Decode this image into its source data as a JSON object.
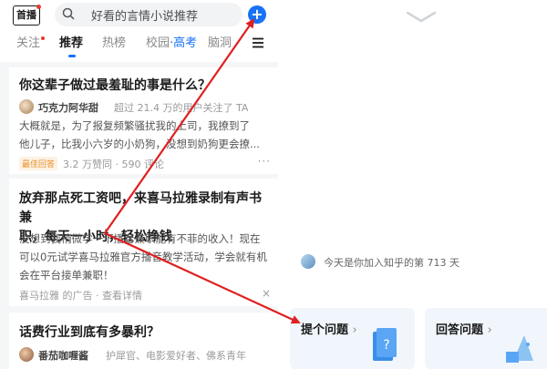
{
  "app": {
    "logo": "首播",
    "search_placeholder": "好看的言情小说推荐",
    "add_button": "+"
  },
  "tabs": [
    {
      "label": "关注"
    },
    {
      "label": "推荐"
    },
    {
      "label": "热榜"
    },
    {
      "label": "校园",
      "suffix": "·高考"
    },
    {
      "label": "脑洞"
    }
  ],
  "feed": [
    {
      "title": "你这辈子做过最羞耻的事是什么？",
      "author": "巧克力阿华甜",
      "meta": "超过 21.4 万的用户关注了 TA",
      "excerpt": [
        "大概就是，为了报复频繁骚扰我的上司，我撩到了",
        "他儿子，比我小六岁的小奶狗，没想到奶狗更会撩..."
      ],
      "tag": "最佳回答",
      "stats": "3.2 万赞同 · 590 评论",
      "more": "···"
    },
    {
      "title": [
        "放弃那点死工资吧，来喜马拉雅录制有声书兼",
        "职，每天一小时，轻松挣钱"
      ],
      "excerpt": [
        "没想到我稍微学一下播音兼职能有不菲的收入！现在",
        "可以0元试学喜马拉雅官方播音教学活动，学会就有机",
        "会在平台接单兼职！"
      ],
      "ad_footer": "喜马拉雅 的广告 · 查看详情",
      "close": "×"
    },
    {
      "title": "话费行业到底有多暴利？",
      "author": "番茄咖喱酱",
      "meta": "护犀官、电影爱好者、佛系青年"
    }
  ],
  "right_panel": {
    "join_text": "今天是你加入知乎的第 713 天",
    "ask_button": "提个问题",
    "answer_button": "回答问题",
    "chevron": "›"
  },
  "colors": {
    "accent": "#1772f6",
    "annotation_arrow": "#e02020",
    "tag_bg": "#fdf2e4",
    "tag_text": "#e6912e"
  }
}
